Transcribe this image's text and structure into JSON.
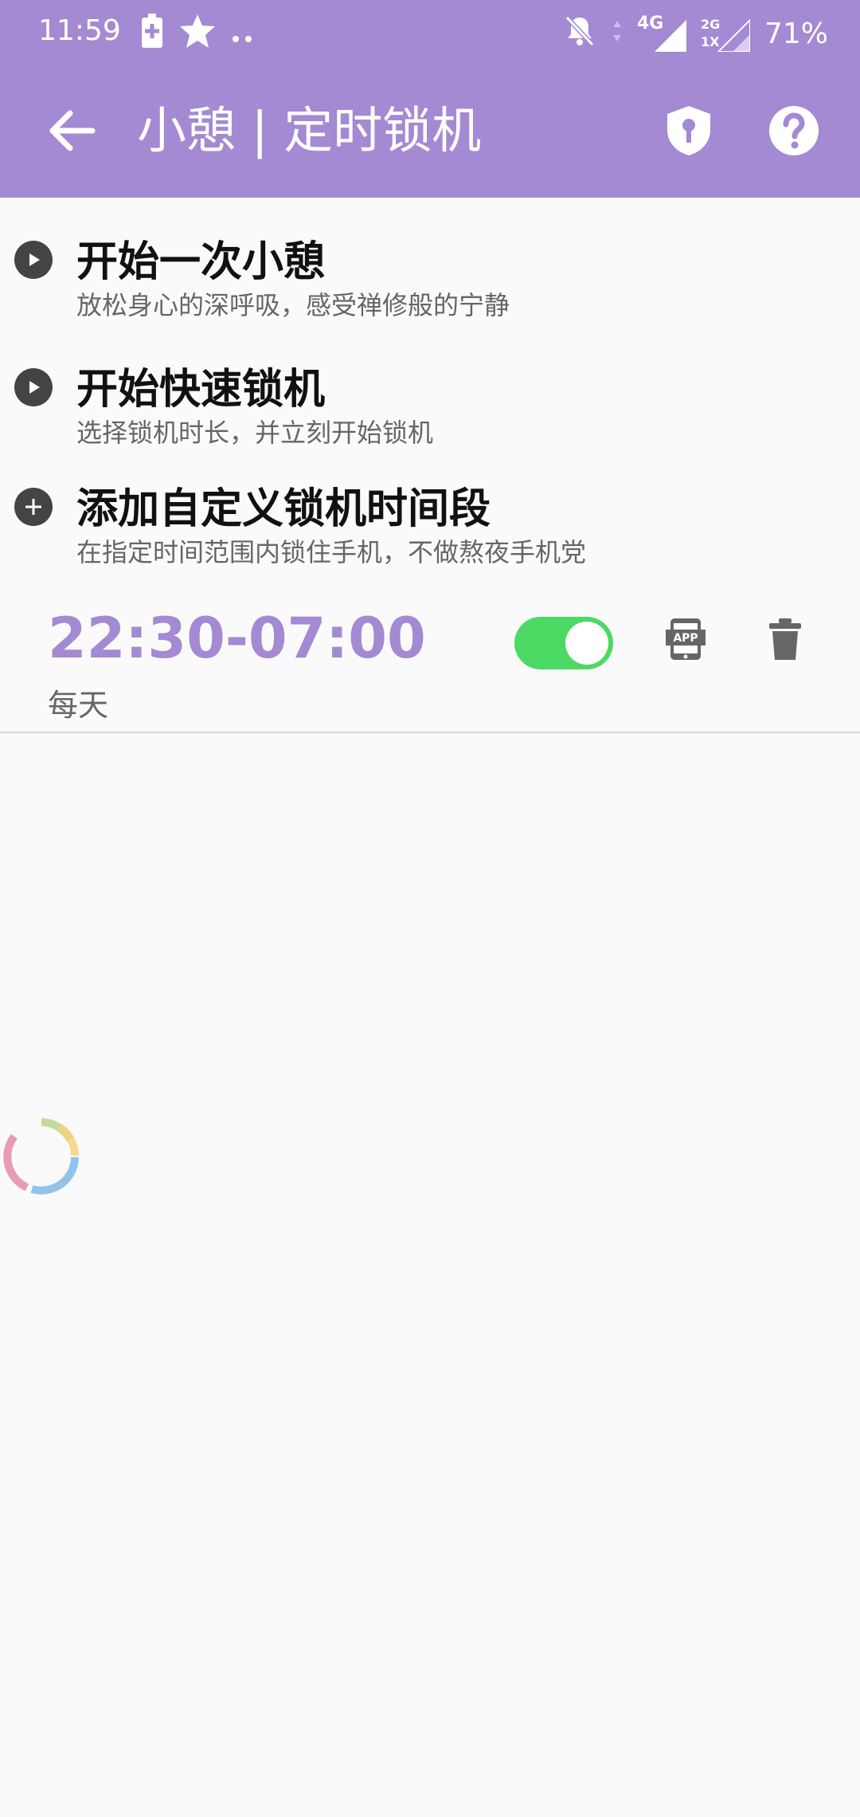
{
  "status_bar": {
    "time": "11:59",
    "network": "4G",
    "sim2_line1": "2G",
    "sim2_line2": "1X",
    "battery": "71%"
  },
  "app_bar": {
    "title": "小憩 | 定时锁机"
  },
  "menu": [
    {
      "title": "开始一次小憩",
      "subtitle": "放松身心的深呼吸，感受禅修般的宁静",
      "icon": "play-icon"
    },
    {
      "title": "开始快速锁机",
      "subtitle": "选择锁机时长，并立刻开始锁机",
      "icon": "play-icon"
    },
    {
      "title": "添加自定义锁机时间段",
      "subtitle": "在指定时间范围内锁住手机，不做熬夜手机党",
      "icon": "plus-icon"
    }
  ],
  "schedule": {
    "time_range": "22:30-07:00",
    "repeat": "每天",
    "enabled": true,
    "app_label": "APP"
  },
  "colors": {
    "accent": "#a38ad2",
    "toggle_on": "#4cd964"
  }
}
